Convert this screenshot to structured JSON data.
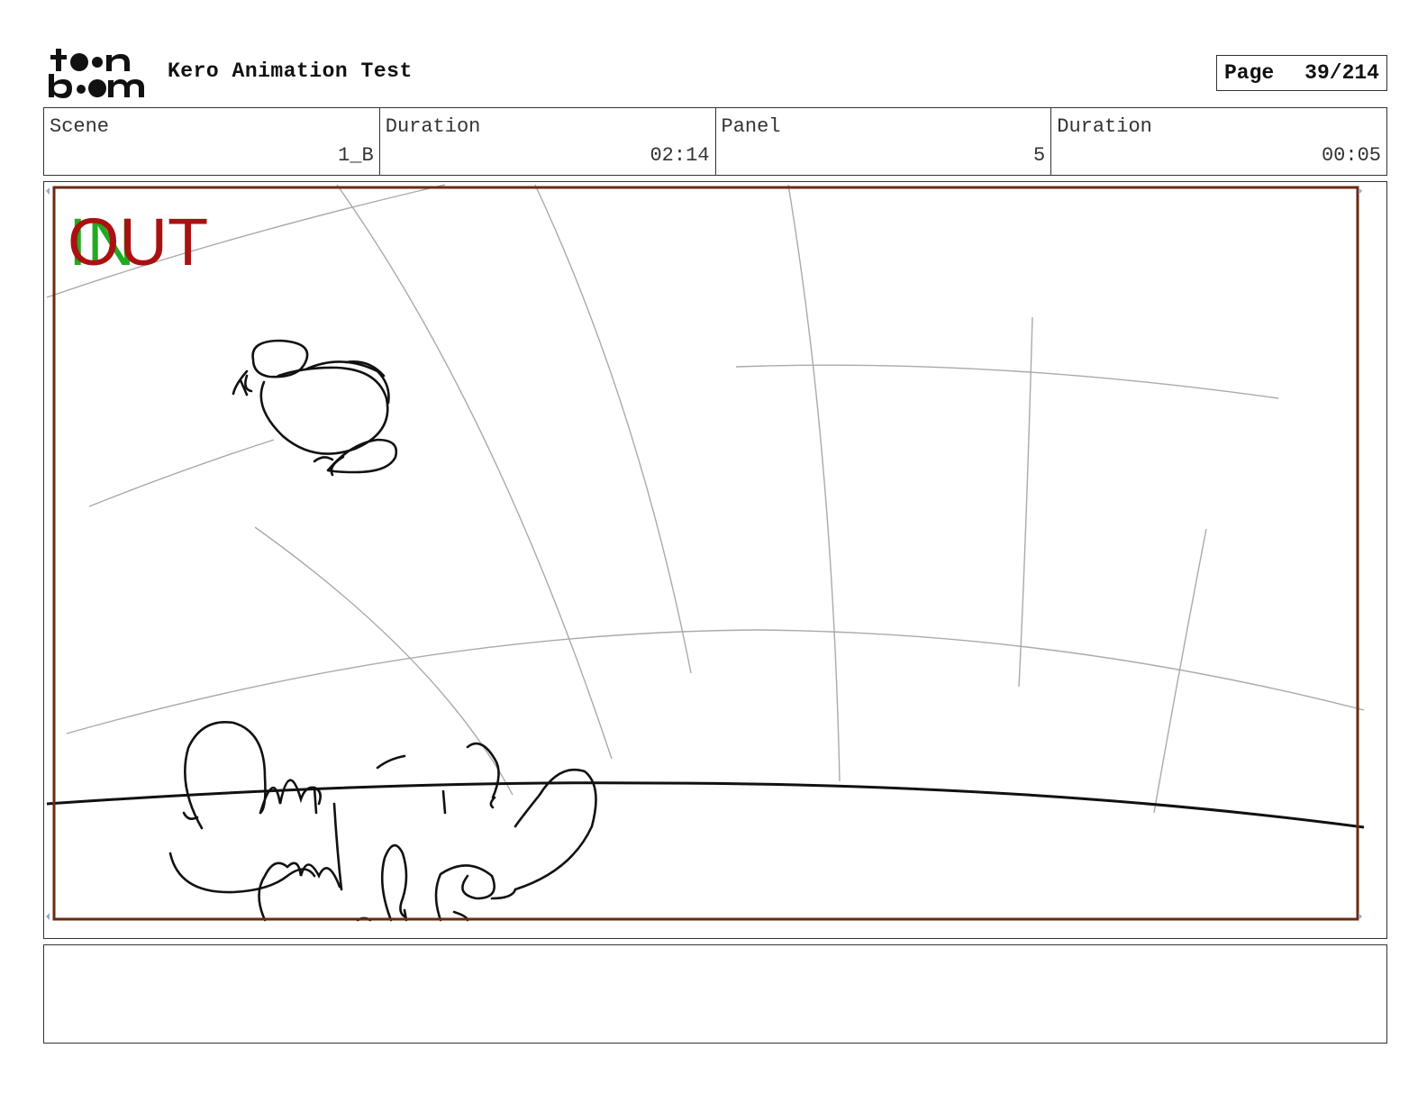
{
  "header": {
    "logo": {
      "line1": "toon",
      "line2": "boom"
    },
    "title": "Kero Animation Test",
    "page_label": "Page",
    "page_value": "39/214"
  },
  "info": {
    "scene_label": "Scene",
    "scene_value": "1_B",
    "duration_label": "Duration",
    "duration_value": "02:14",
    "panel_label": "Panel",
    "panel_value": "5",
    "panel_duration_label": "Duration",
    "panel_duration_value": "00:05"
  },
  "panel": {
    "in_marker": "IN",
    "out_marker": "OUT",
    "in_color": "#22aa22",
    "out_color": "#aa1111",
    "frame_color": "#6b2a12"
  },
  "notes": {
    "text": ""
  }
}
